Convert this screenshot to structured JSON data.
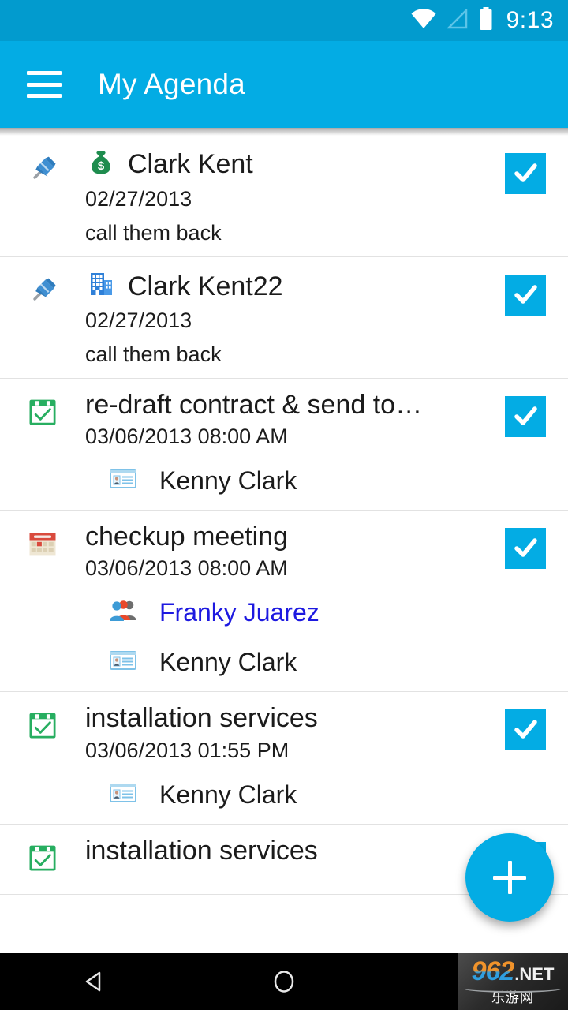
{
  "status_bar": {
    "time": "9:13",
    "icons": [
      "wifi-icon",
      "cell-signal-icon",
      "battery-icon"
    ],
    "background_color": "#029BCE"
  },
  "app_bar": {
    "menu_label": "menu",
    "title": "My Agenda",
    "background_color": "#03ACE4"
  },
  "agenda": {
    "items": [
      {
        "lead_icon": "pushpin-icon",
        "type_icon": "money-bag-icon",
        "title": "Clark Kent",
        "date": "02/27/2013",
        "note": "call them back",
        "checked": true,
        "sub_rows": []
      },
      {
        "lead_icon": "pushpin-icon",
        "type_icon": "office-building-icon",
        "title": "Clark Kent22",
        "date": "02/27/2013",
        "note": "call them back",
        "checked": true,
        "sub_rows": []
      },
      {
        "lead_icon": "calendar-check-icon",
        "type_icon": "",
        "title": "re-draft contract & send to…",
        "date": "03/06/2013 08:00 AM",
        "note": "",
        "checked": true,
        "sub_rows": [
          {
            "icon": "id-card-icon",
            "text": "Kenny Clark",
            "is_link": false
          }
        ]
      },
      {
        "lead_icon": "spiral-calendar-icon",
        "type_icon": "",
        "title": "checkup meeting",
        "date": "03/06/2013 08:00 AM",
        "note": "",
        "checked": true,
        "sub_rows": [
          {
            "icon": "people-group-icon",
            "text": "Franky Juarez",
            "is_link": true
          },
          {
            "icon": "id-card-icon",
            "text": "Kenny Clark",
            "is_link": false
          }
        ]
      },
      {
        "lead_icon": "calendar-check-icon",
        "type_icon": "",
        "title": "installation services",
        "date": "03/06/2013 01:55 PM",
        "note": "",
        "checked": true,
        "sub_rows": [
          {
            "icon": "id-card-icon",
            "text": "Kenny Clark",
            "is_link": false
          }
        ]
      },
      {
        "lead_icon": "calendar-check-icon",
        "type_icon": "",
        "title": "installation services",
        "date": "",
        "note": "",
        "checked": true,
        "sub_rows": []
      }
    ]
  },
  "fab": {
    "name": "add-button",
    "label": "+",
    "background_color": "#03ACE4"
  },
  "nav_bar": {
    "buttons": [
      "back-button",
      "home-button",
      "recents-button"
    ],
    "background_color": "#000000"
  },
  "watermark": {
    "number": "962",
    "tld": ".NET",
    "chinese": "乐游网"
  },
  "colors": {
    "accent": "#03ACE4",
    "status_bar": "#029BCE",
    "link": "#1d19e0",
    "divider": "#e2e2e2"
  }
}
